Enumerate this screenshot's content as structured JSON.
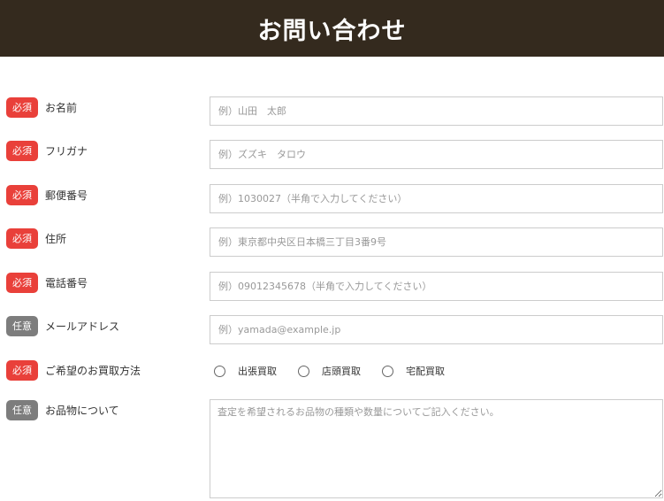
{
  "header": {
    "title": "お問い合わせ"
  },
  "badges": {
    "required": "必須",
    "optional": "任意"
  },
  "fields": [
    {
      "label": "お名前",
      "required": true,
      "placeholder": "例）山田　太郎"
    },
    {
      "label": "フリガナ",
      "required": true,
      "placeholder": "例）ズズキ　タロウ"
    },
    {
      "label": "郵便番号",
      "required": true,
      "placeholder": "例）1030027（半角で入力してください）"
    },
    {
      "label": "住所",
      "required": true,
      "placeholder": "例）東京都中央区日本橋三丁目3番9号"
    },
    {
      "label": "電話番号",
      "required": true,
      "placeholder": "例）09012345678（半角で入力してください）"
    },
    {
      "label": "メールアドレス",
      "required": false,
      "placeholder": "例）yamada@example.jp"
    }
  ],
  "purchase_method": {
    "label": "ご希望のお買取方法",
    "required": true,
    "options": [
      "出張買取",
      "店頭買取",
      "宅配買取"
    ]
  },
  "items": {
    "label": "お品物について",
    "required": false,
    "placeholder": "査定を希望されるお品物の種類や数量についてご記入ください。"
  },
  "colors": {
    "header_bg": "#342a1e",
    "required_badge": "#e9403a",
    "optional_badge": "#7d7d7d"
  }
}
